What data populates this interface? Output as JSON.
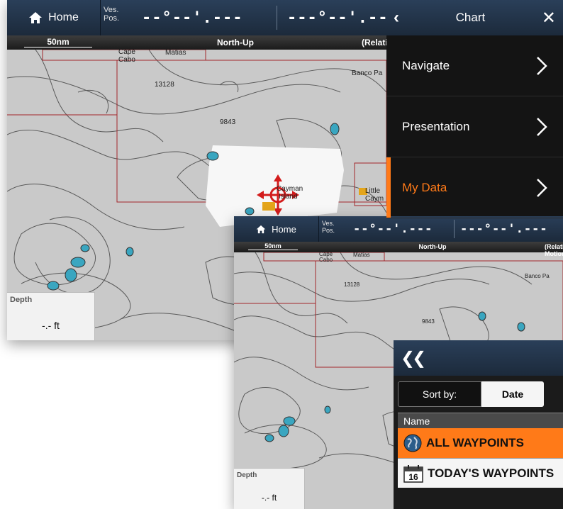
{
  "topbar": {
    "home_label": "Home",
    "ves_line1": "Ves.",
    "ves_line2": "Pos.",
    "lat": "--°--'.---",
    "lon": "---°--'.---"
  },
  "subbar": {
    "scale": "50nm",
    "orientation": "North-Up",
    "motion": "(Relative Motion)"
  },
  "map_labels": {
    "place1": "Cape",
    "place2": "Cabo",
    "place3": "Matias",
    "bank": "Banco Pa",
    "depth1": "13128",
    "depth2": "9843",
    "island1": "Cayman",
    "island2": "Island",
    "little1": "Little",
    "little2": "Caym"
  },
  "depth": {
    "label": "Depth",
    "value": "-.- ft"
  },
  "chart_menu": {
    "title": "Chart",
    "items": [
      {
        "label": "Navigate"
      },
      {
        "label": "Presentation"
      },
      {
        "label": "My Data"
      }
    ]
  },
  "waypoints": {
    "sort_label": "Sort by:",
    "sort_value": "Date",
    "column": "Name",
    "rows": [
      {
        "label": "ALL WAYPOINTS"
      },
      {
        "label": "TODAY'S WAYPOINTS"
      }
    ],
    "calendar_day": "16"
  },
  "colors": {
    "accent": "#ff7a18",
    "bar": "#1c2a3b",
    "land_water": "#c9c9c9",
    "shoal": "#3aa6c0"
  }
}
